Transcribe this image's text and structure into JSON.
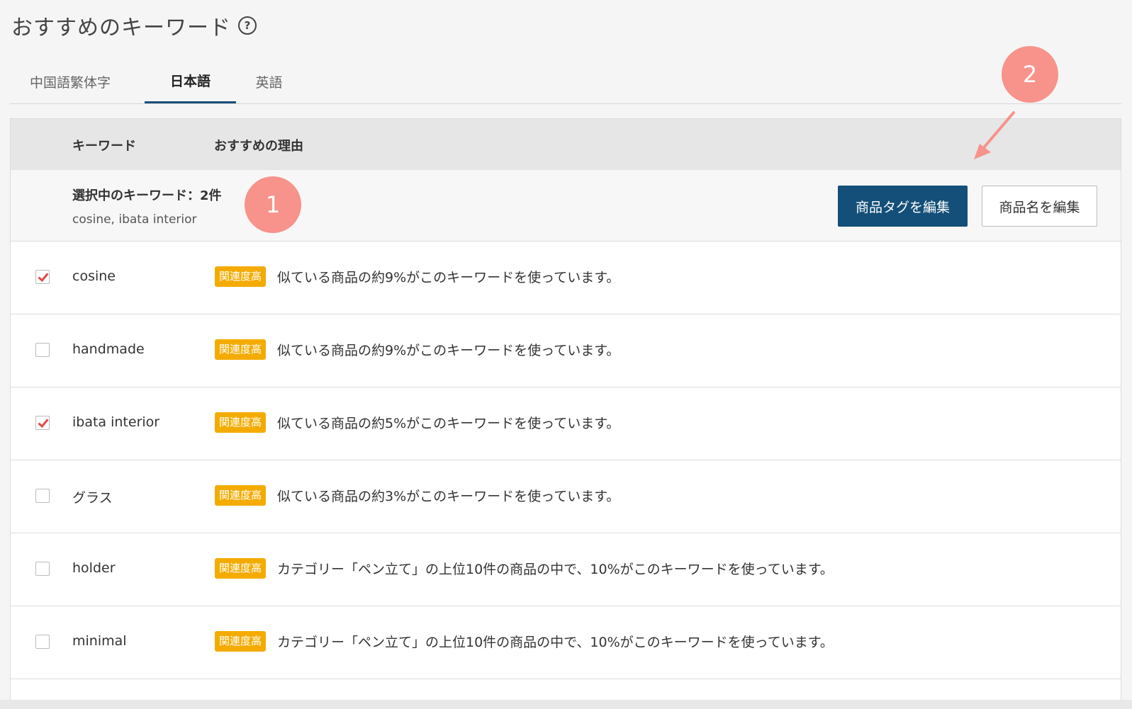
{
  "page": {
    "title": "おすすめのキーワード",
    "help_icon_glyph": "?"
  },
  "tabs": [
    {
      "label": "中国語繁体字",
      "active": false
    },
    {
      "label": "日本語",
      "active": true
    },
    {
      "label": "英語",
      "active": false
    }
  ],
  "table": {
    "headers": {
      "keyword": "キーワード",
      "reason": "おすすめの理由"
    },
    "selection": {
      "count_label": "選択中のキーワード：2件",
      "list": "cosine, ibata interior",
      "edit_tags_button": "商品タグを編集",
      "edit_name_button": "商品名を編集"
    },
    "rows": [
      {
        "keyword": "cosine",
        "checked": true,
        "badge": "関連度高",
        "reason": "似ている商品の約9%がこのキーワードを使っています。"
      },
      {
        "keyword": "handmade",
        "checked": false,
        "badge": "関連度高",
        "reason": "似ている商品の約9%がこのキーワードを使っています。"
      },
      {
        "keyword": "ibata interior",
        "checked": true,
        "badge": "関連度高",
        "reason": "似ている商品の約5%がこのキーワードを使っています。"
      },
      {
        "keyword": "グラス",
        "checked": false,
        "badge": "関連度高",
        "reason": "似ている商品の約3%がこのキーワードを使っています。"
      },
      {
        "keyword": "holder",
        "checked": false,
        "badge": "関連度高",
        "reason": "カテゴリー「ペン立て」の上位10件の商品の中で、10%がこのキーワードを使っています。"
      },
      {
        "keyword": "minimal",
        "checked": false,
        "badge": "関連度高",
        "reason": "カテゴリー「ペン立て」の上位10件の商品の中で、10%がこのキーワードを使っています。"
      }
    ]
  },
  "annotations": {
    "marker1": "1",
    "marker2": "2"
  },
  "colors": {
    "primary_button": "#134f78",
    "badge": "#f4ab00",
    "checkmark": "#e04848",
    "marker": "#f7938a"
  }
}
